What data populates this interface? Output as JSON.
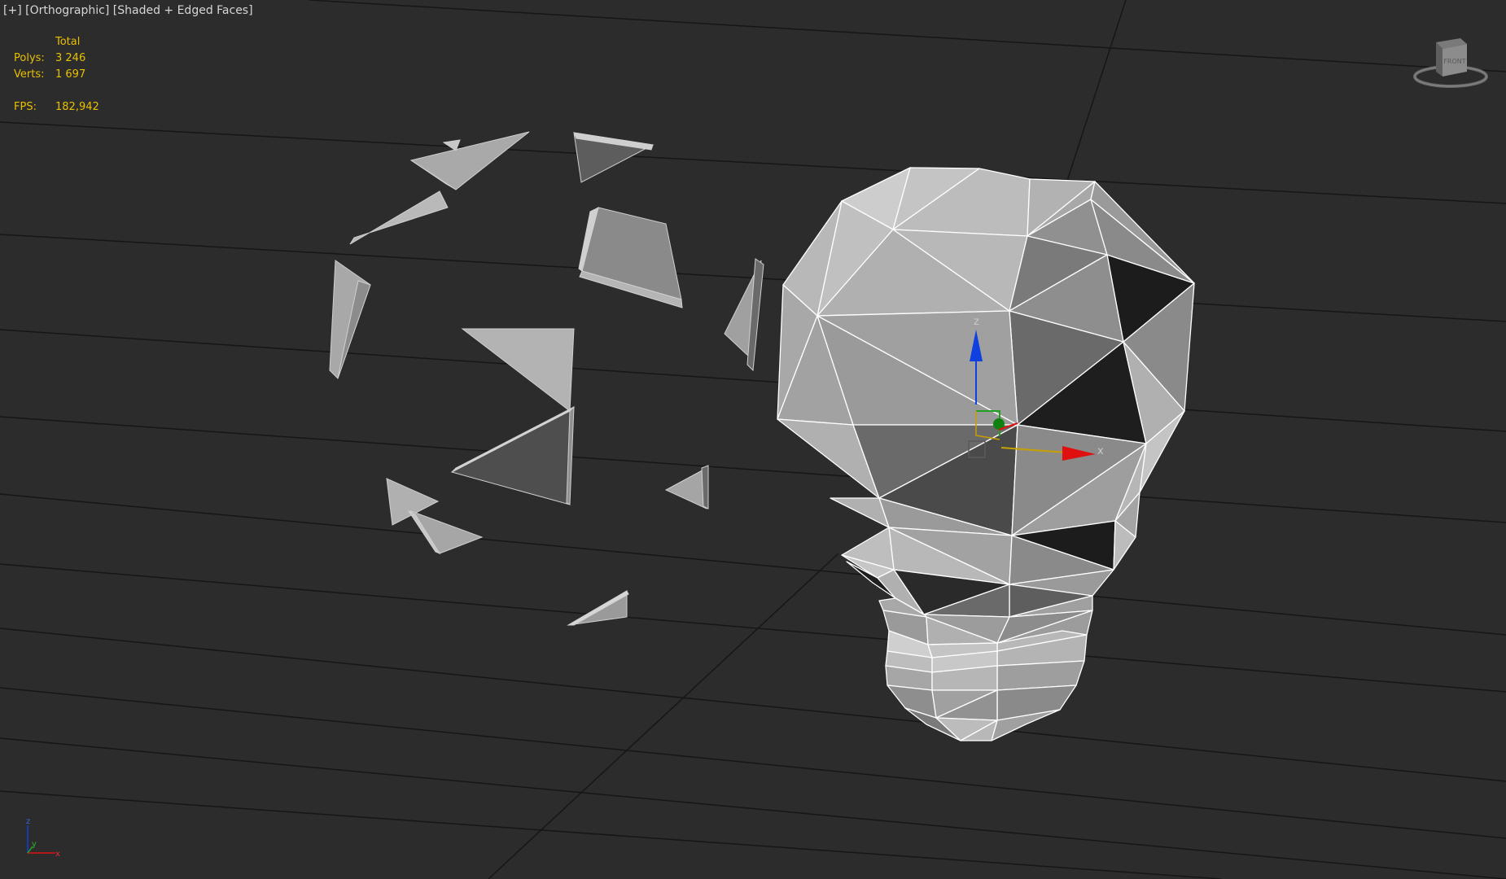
{
  "viewport": {
    "label_plus": "[+]",
    "label_view": "[Orthographic]",
    "label_shading": "[Shaded + Edged Faces]",
    "stats": {
      "header": "Total",
      "polys_label": "Polys:",
      "polys_value": "3 246",
      "verts_label": "Verts:",
      "verts_value": "1 697",
      "fps_label": "FPS:",
      "fps_value": "182,942"
    },
    "viewcube_face": "FRONT",
    "gizmo": {
      "x_label": "x",
      "y_label": "y",
      "z_label": "z"
    },
    "tripod": {
      "x_label": "x",
      "y_label": "y",
      "z_label": "z"
    }
  },
  "colors": {
    "background": "#2c2c2c",
    "grid_line": "#141414",
    "mesh_edge": "#ffffff",
    "stats_text": "#e8c000",
    "axis_x": "#e01010",
    "axis_y": "#20a020",
    "axis_z": "#1040e0"
  },
  "icons": {
    "viewcube": "viewcube-icon",
    "gizmo": "move-gizmo-icon",
    "tripod": "world-axis-tripod-icon"
  }
}
